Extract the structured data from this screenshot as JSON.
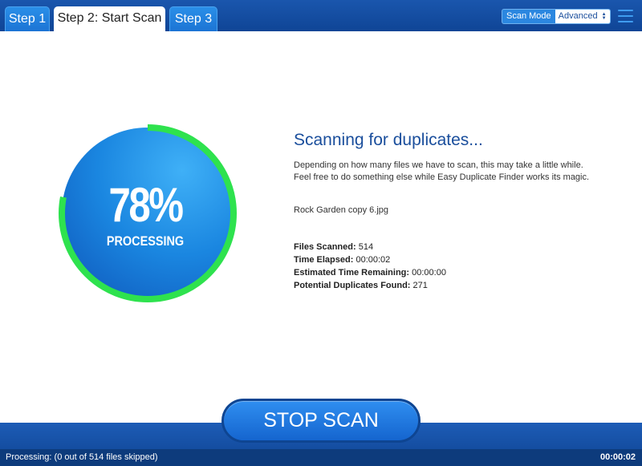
{
  "tabs": [
    {
      "label": "Step 1",
      "active": false
    },
    {
      "label": "Step 2: Start Scan",
      "active": true
    },
    {
      "label": "Step 3",
      "active": false
    }
  ],
  "scan_mode": {
    "label": "Scan Mode",
    "selected": "Advanced"
  },
  "menu_icon": "hamburger-menu-icon",
  "progress": {
    "percent_text": "78%",
    "fraction": 0.78,
    "status": "PROCESSING"
  },
  "info": {
    "title": "Scanning for duplicates...",
    "description": "Depending on how many files we have to scan, this may take a little while. Feel free to do something else while Easy Duplicate Finder works its magic.",
    "current_file": "Rock Garden copy 6.jpg",
    "stats": [
      {
        "label": "Files Scanned:",
        "value": "514"
      },
      {
        "label": "Time Elapsed:",
        "value": "00:00:02"
      },
      {
        "label": "Estimated Time Remaining:",
        "value": "00:00:00"
      },
      {
        "label": "Potential Duplicates Found:",
        "value": "271"
      }
    ]
  },
  "stop_button": {
    "label": "STOP SCAN"
  },
  "status_bar": {
    "left": "Processing: (0 out of 514 files skipped)",
    "right": "00:00:02"
  },
  "colors": {
    "ring": "#2ee24e",
    "accent": "#1a4e9c",
    "topbar": "#1a56ad"
  }
}
